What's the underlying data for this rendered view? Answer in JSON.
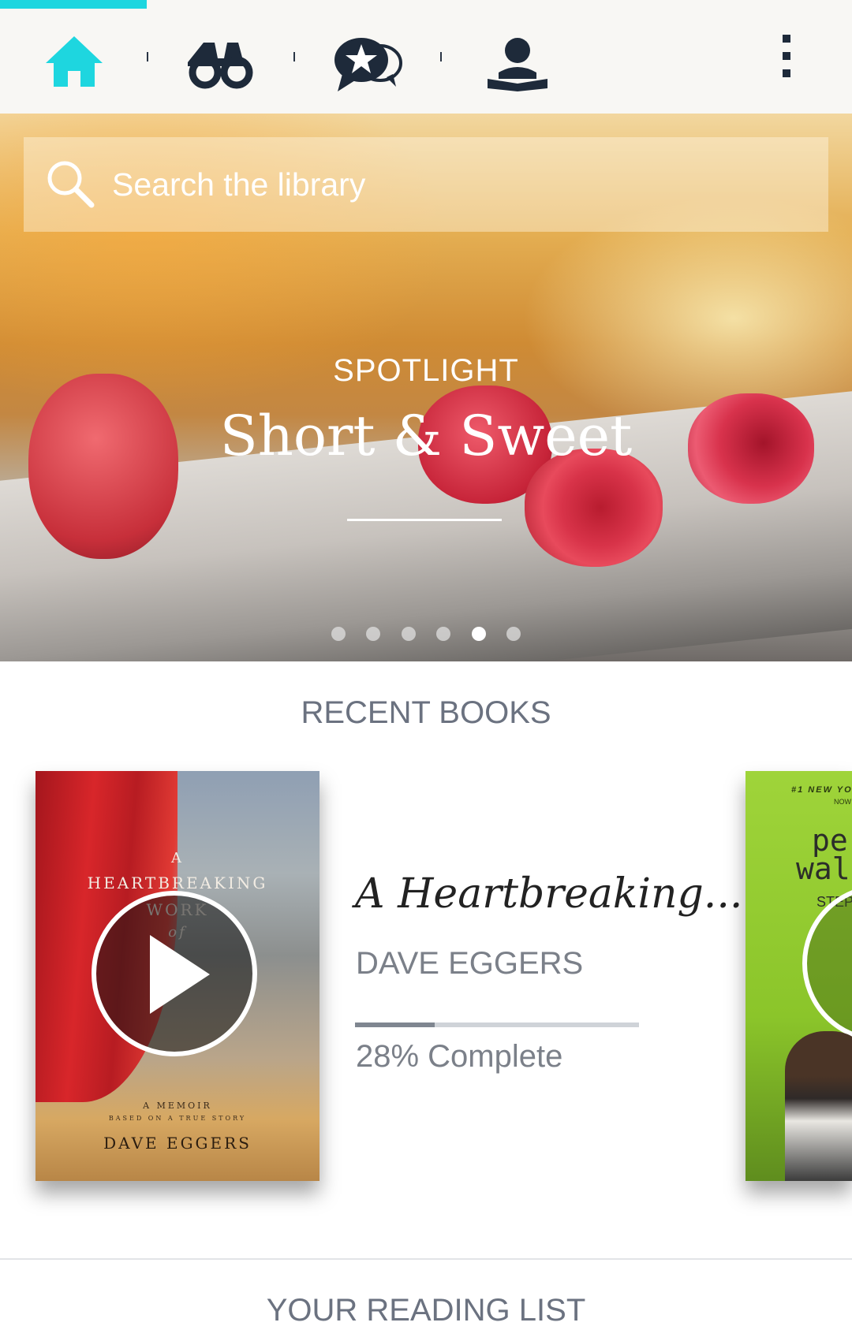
{
  "nav": {
    "tabs": [
      {
        "id": "home",
        "icon": "home-icon",
        "active": true
      },
      {
        "id": "discover",
        "icon": "binoculars-icon",
        "active": false
      },
      {
        "id": "recommendations",
        "icon": "star-chat-icon",
        "active": false
      },
      {
        "id": "profile",
        "icon": "reader-icon",
        "active": false
      }
    ],
    "menu_icon": "more-vertical-icon",
    "accent_color": "#1ed6df",
    "icon_color": "#1e2a3a"
  },
  "search": {
    "placeholder": "Search the library"
  },
  "spotlight": {
    "eyebrow": "SPOTLIGHT",
    "title": "Short & Sweet",
    "slide_count": 6,
    "active_slide": 5
  },
  "recent_books": {
    "section_title": "RECENT BOOKS",
    "items": [
      {
        "title": "A Heartbreaking...",
        "author": "DAVE EGGERS",
        "progress_fraction": 0.28,
        "progress_label": "28% Complete",
        "cover_text": {
          "top": "A",
          "line1": "HEARTBREAKING",
          "line2": "WORK",
          "line3": "of",
          "subtitle": "A MEMOIR",
          "subtitle2": "BASED ON A TRUE STORY",
          "author": "DAVE EGGERS"
        }
      },
      {
        "cover_text": {
          "tag": "#1 NEW YO",
          "tag2": "NOW",
          "title1": "pe",
          "title2": "wal",
          "author": "STEP"
        }
      }
    ]
  },
  "reading_list": {
    "section_title": "YOUR READING LIST"
  }
}
